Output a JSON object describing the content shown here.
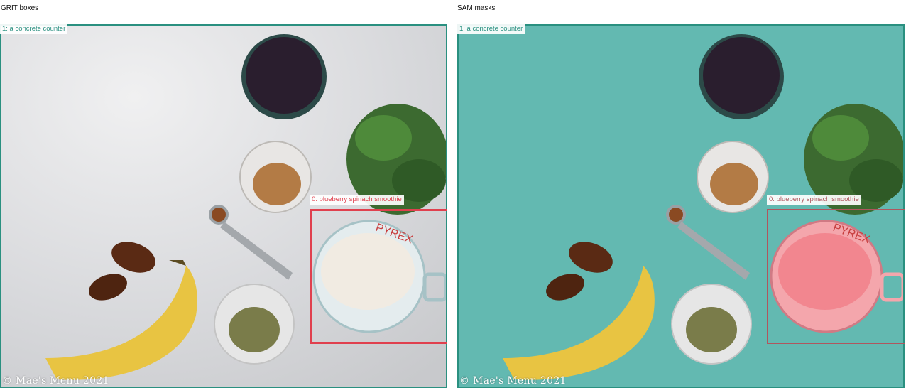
{
  "panels": {
    "left": {
      "title": "GRIT boxes"
    },
    "right": {
      "title": "SAM masks"
    }
  },
  "detections": {
    "counter": {
      "label": "1: a concrete counter",
      "color": "#2a9080"
    },
    "smoothie": {
      "label": "0: blueberry spinach smoothie",
      "color": "#e0404e"
    }
  },
  "watermark": "© Mae's Menu 2021",
  "colors": {
    "counter_mask": "#5fb8b0",
    "smoothie_mask": "#f08a94"
  }
}
